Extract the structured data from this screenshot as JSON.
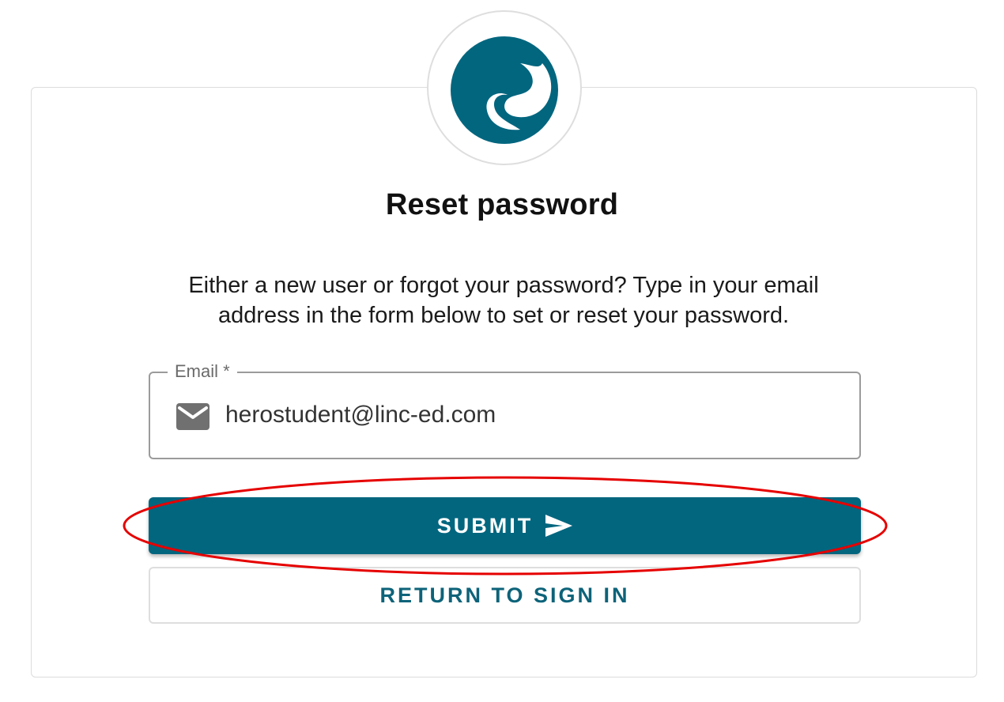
{
  "page": {
    "title": "Reset password",
    "description": "Either a new user or forgot your password? Type in your email address in the form below to set or reset your password."
  },
  "logo": {
    "icon": "linc-ed-logo-icon",
    "color": "#02667f"
  },
  "email_field": {
    "label": "Email *",
    "value": "herostudent@linc-ed.com",
    "icon": "mail-icon"
  },
  "buttons": {
    "submit_label": "SUBMIT",
    "submit_icon": "send-icon",
    "return_label": "RETURN TO SIGN IN"
  },
  "colors": {
    "primary": "#02667f",
    "annotation": "#e60000"
  }
}
